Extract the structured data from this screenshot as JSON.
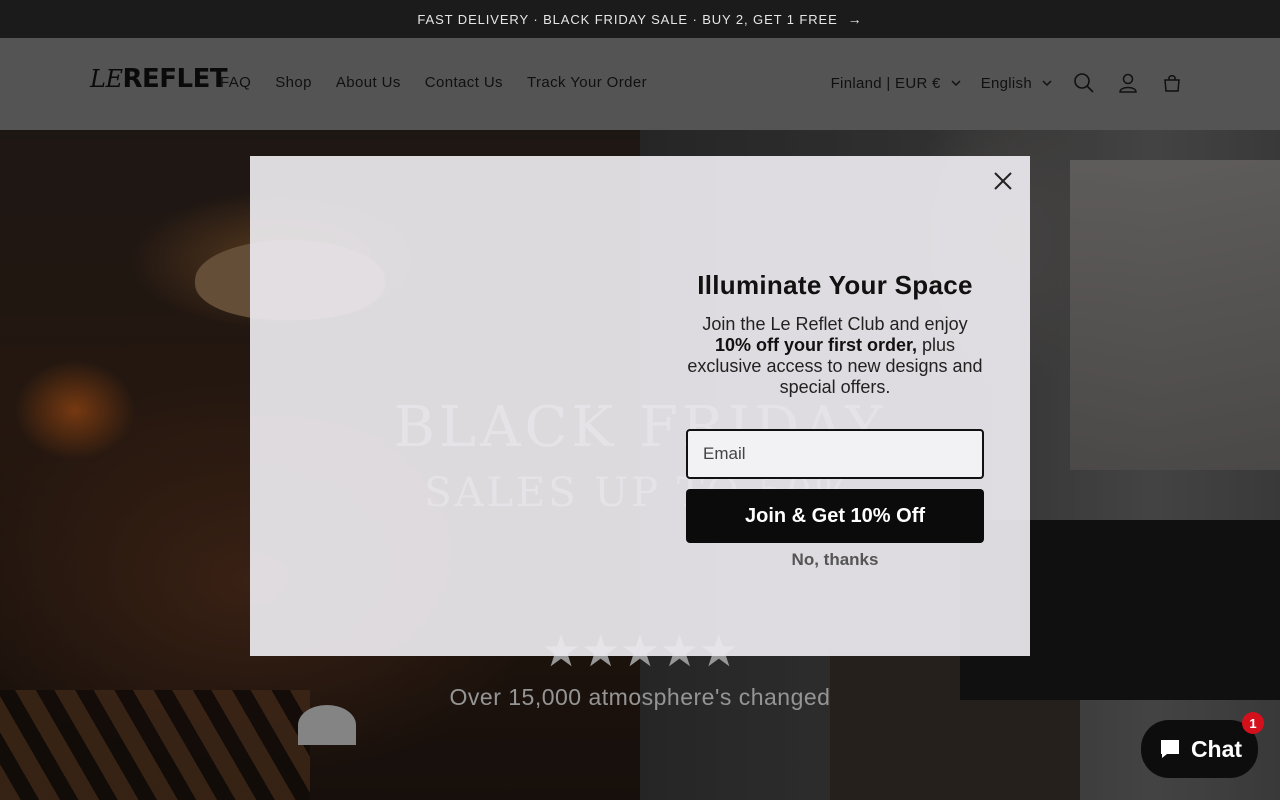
{
  "announcement": {
    "text": "FAST DELIVERY · BLACK FRIDAY SALE · BUY 2, GET 1 FREE",
    "arrow_icon": "arrow-right-icon"
  },
  "header": {
    "logo_prefix": "LE",
    "logo_main": "REFLET",
    "nav": [
      "FAQ",
      "Shop",
      "About Us",
      "Contact Us",
      "Track Your Order"
    ],
    "country_selector": "Finland | EUR €",
    "language_selector": "English",
    "icons": [
      "search-icon",
      "account-icon",
      "cart-icon"
    ]
  },
  "hero": {
    "title": "BLACK FRIDAY",
    "subtitle": "SALES UP TO 50%",
    "stars": "★★★★★",
    "rating_value": 5,
    "rating_max": 5,
    "reviews_text": "Over 15,000 atmosphere's changed"
  },
  "popup": {
    "title": "Illuminate Your Space",
    "body_before": "Join the Le Reflet Club and enjoy",
    "body_bold": "10% off your first order,",
    "body_after": "plus exclusive access to new designs and special offers.",
    "email_placeholder": "Email",
    "email_value": "",
    "submit_label": "Join & Get 10% Off",
    "dismiss_label": "No, thanks",
    "close_icon": "close-icon"
  },
  "chat": {
    "label": "Chat",
    "badge_count": "1",
    "icon": "chat-bubble-icon"
  },
  "colors": {
    "announcement_bg": "#1b1b1b",
    "button_bg": "#0b0b0b",
    "badge": "#d4101c"
  }
}
